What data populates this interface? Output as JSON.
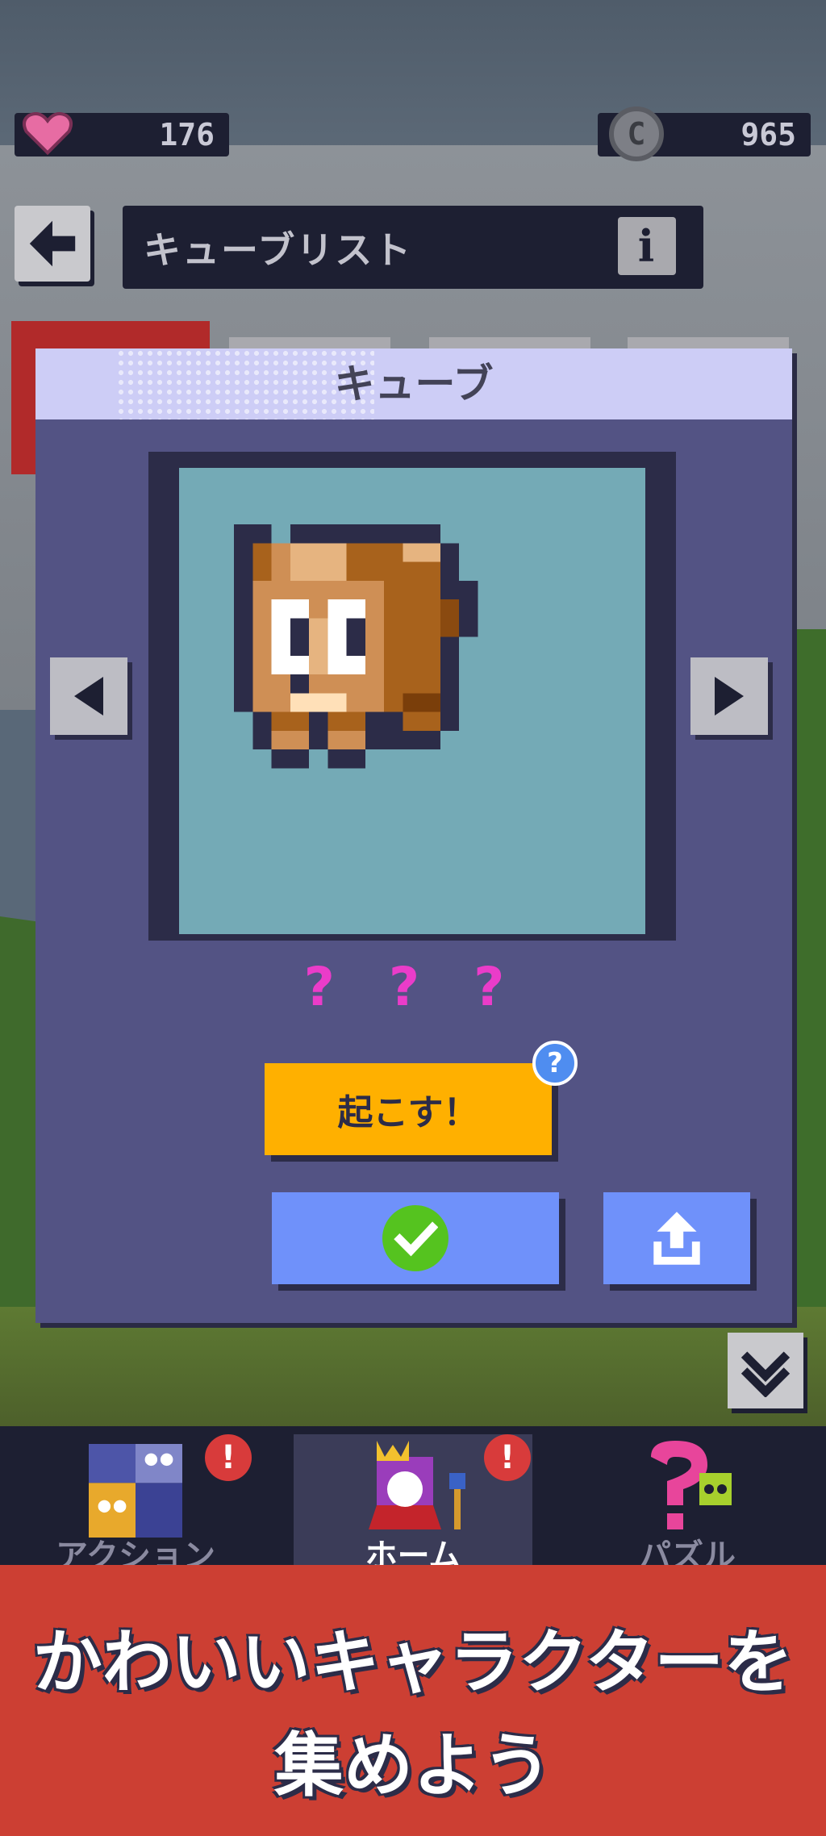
{
  "status": {
    "hearts": "176",
    "coins": "965"
  },
  "header": {
    "title": "キューブリスト",
    "info_label": "i"
  },
  "modal": {
    "title": "キューブ",
    "character_name": "? ? ?",
    "wake_button_label": "起こす！",
    "help_badge": "?"
  },
  "nav": {
    "items": [
      {
        "label": "アクション",
        "alert": "!"
      },
      {
        "label": "ホーム",
        "alert": "!"
      },
      {
        "label": "パズル"
      }
    ]
  },
  "banner": {
    "line1": "かわいいキャラクターを",
    "line2": "集めよう"
  },
  "icons": {
    "hearts": "heart-icon",
    "coins": "coin-icon",
    "back": "back-arrow-icon",
    "info": "info-icon",
    "prev": "left-arrow-icon",
    "next": "right-arrow-icon",
    "confirm": "check-icon",
    "share": "share-icon",
    "collapse": "chevron-down-icon"
  },
  "colors": {
    "wake_button": "#ffb000",
    "primary_button": "#6f91fa",
    "banner": "#cc3f33",
    "modal": "#535384"
  }
}
